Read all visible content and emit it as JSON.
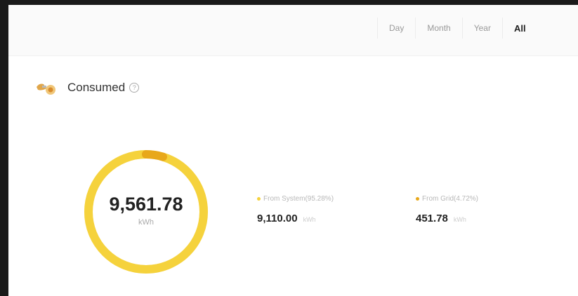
{
  "period_tabs": [
    {
      "label": "Day",
      "active": false
    },
    {
      "label": "Month",
      "active": false
    },
    {
      "label": "Year",
      "active": false
    },
    {
      "label": "All",
      "active": true
    }
  ],
  "section": {
    "title": "Consumed",
    "info_icon": "info-circle-icon",
    "icon": "house-plug-icon"
  },
  "ring": {
    "value": "9,561.78",
    "unit": "kWh",
    "system_fraction": 0.9528,
    "grid_fraction": 0.0472,
    "system_color": "#f5d23c",
    "grid_color": "#e8a81a"
  },
  "stats": [
    {
      "label": "From System(95.28%)",
      "value": "9,110.00",
      "unit": "kWh",
      "color": "#f5d23c"
    },
    {
      "label": "From Grid(4.72%)",
      "value": "451.78",
      "unit": "kWh",
      "color": "#e8a81a"
    }
  ]
}
